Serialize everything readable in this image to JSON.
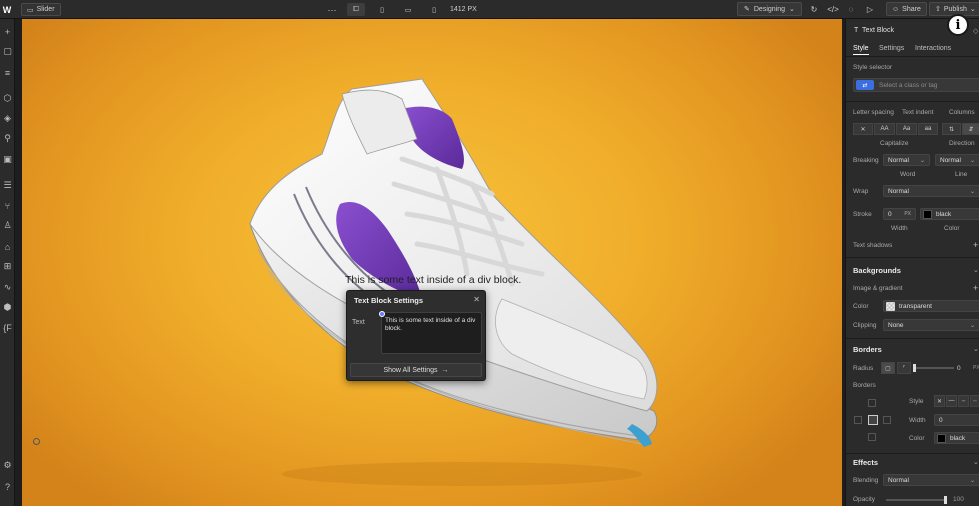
{
  "topbar": {
    "logo": "W",
    "page_name": "Slider",
    "more": "···",
    "width_value": "1412 PX",
    "mode": "Designing",
    "share": "Share",
    "publish": "Publish"
  },
  "canvas": {
    "text_block": "This is some text inside of a div block."
  },
  "popover": {
    "title": "Text Block Settings",
    "text_label": "Text",
    "text_value": "This is some text inside of a div block.",
    "button": "Show All Settings"
  },
  "panel": {
    "element_type": "Text Block",
    "tabs": [
      "Style",
      "Settings",
      "Interactions"
    ],
    "style_selector_label": "Style selector",
    "style_selector_placeholder": "Select a class or tag",
    "typography": {
      "letter_spacing": "Letter spacing",
      "text_indent": "Text indent",
      "columns": "Columns",
      "capitalize": "Capitalize",
      "direction": "Direction",
      "case_options": [
        "AA",
        "Aa",
        "aa"
      ],
      "breaking_label": "Breaking",
      "breaking_value": "Normal",
      "breaking_line_value": "Normal",
      "word": "Word",
      "line": "Line",
      "wrap_label": "Wrap",
      "wrap_value": "Normal",
      "stroke_label": "Stroke",
      "stroke_width": "0",
      "stroke_unit": "PX",
      "stroke_color": "black",
      "width": "Width",
      "color": "Color",
      "text_shadows": "Text shadows"
    },
    "backgrounds": {
      "title": "Backgrounds",
      "image_gradient": "Image & gradient",
      "color_label": "Color",
      "color_value": "transparent",
      "clipping_label": "Clipping",
      "clipping_value": "None"
    },
    "borders": {
      "title": "Borders",
      "radius_label": "Radius",
      "radius_value": "0",
      "radius_unit": "PX",
      "borders_label": "Borders",
      "style_label": "Style",
      "width_label": "Width",
      "width_value": "0",
      "color_label": "Color",
      "color_value": "black"
    },
    "effects": {
      "title": "Effects",
      "blending_label": "Blending",
      "blending_value": "Normal",
      "opacity_label": "Opacity",
      "opacity_value": "100"
    }
  },
  "colors": {
    "accent": "#3b6fe0",
    "canvas_bg": "#f0ae2b",
    "panel_bg": "#2b2b2b"
  },
  "icons": {
    "left_toolbar": [
      "plus-icon",
      "page-icon",
      "navigator-icon",
      "components-icon",
      "style-manager-icon",
      "variables-icon",
      "assets-icon",
      "cms-icon",
      "logic-icon",
      "users-icon",
      "ecommerce-icon",
      "apps-icon",
      "audit-icon",
      "packages-icon",
      "code-icon",
      "settings-icon",
      "help-icon"
    ]
  }
}
